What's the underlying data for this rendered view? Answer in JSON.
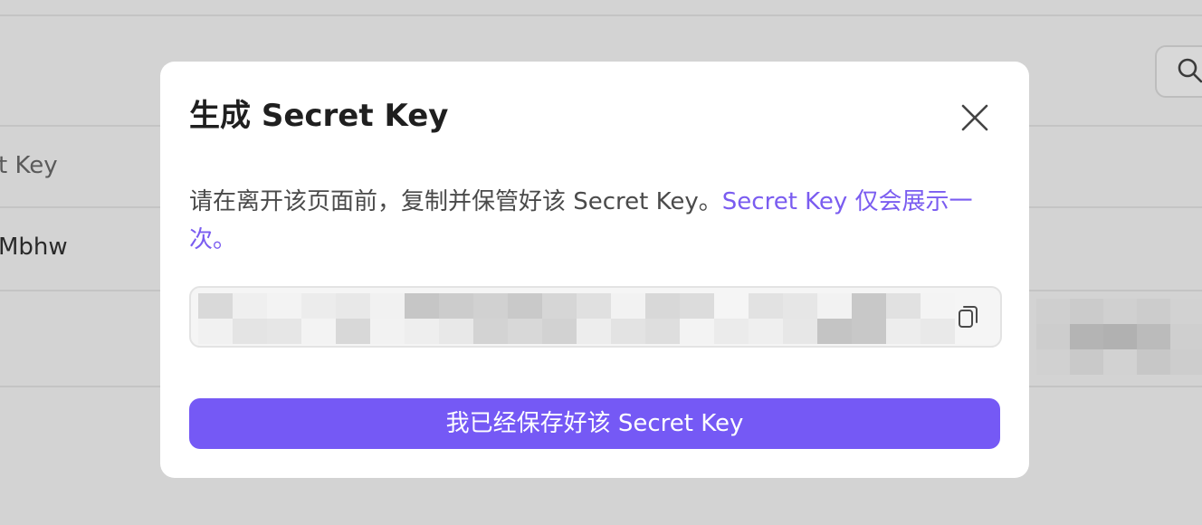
{
  "background": {
    "key_column_label": "t Key",
    "key_value_fragment": "Mbhw",
    "search_icon": "search-icon"
  },
  "modal": {
    "title": "生成 Secret Key",
    "close_icon": "close-icon",
    "description": "请在离开该页面前，复制并保管好该 Secret Key。",
    "description_highlight": "Secret Key 仅会展示一次。",
    "secret_key_masked": true,
    "copy_icon": "copy-icon",
    "confirm_label": "我已经保存好该 Secret Key"
  },
  "colors": {
    "accent": "#7559f5",
    "highlight_text": "#7a5cf0",
    "overlay": "#d3d3d3"
  }
}
